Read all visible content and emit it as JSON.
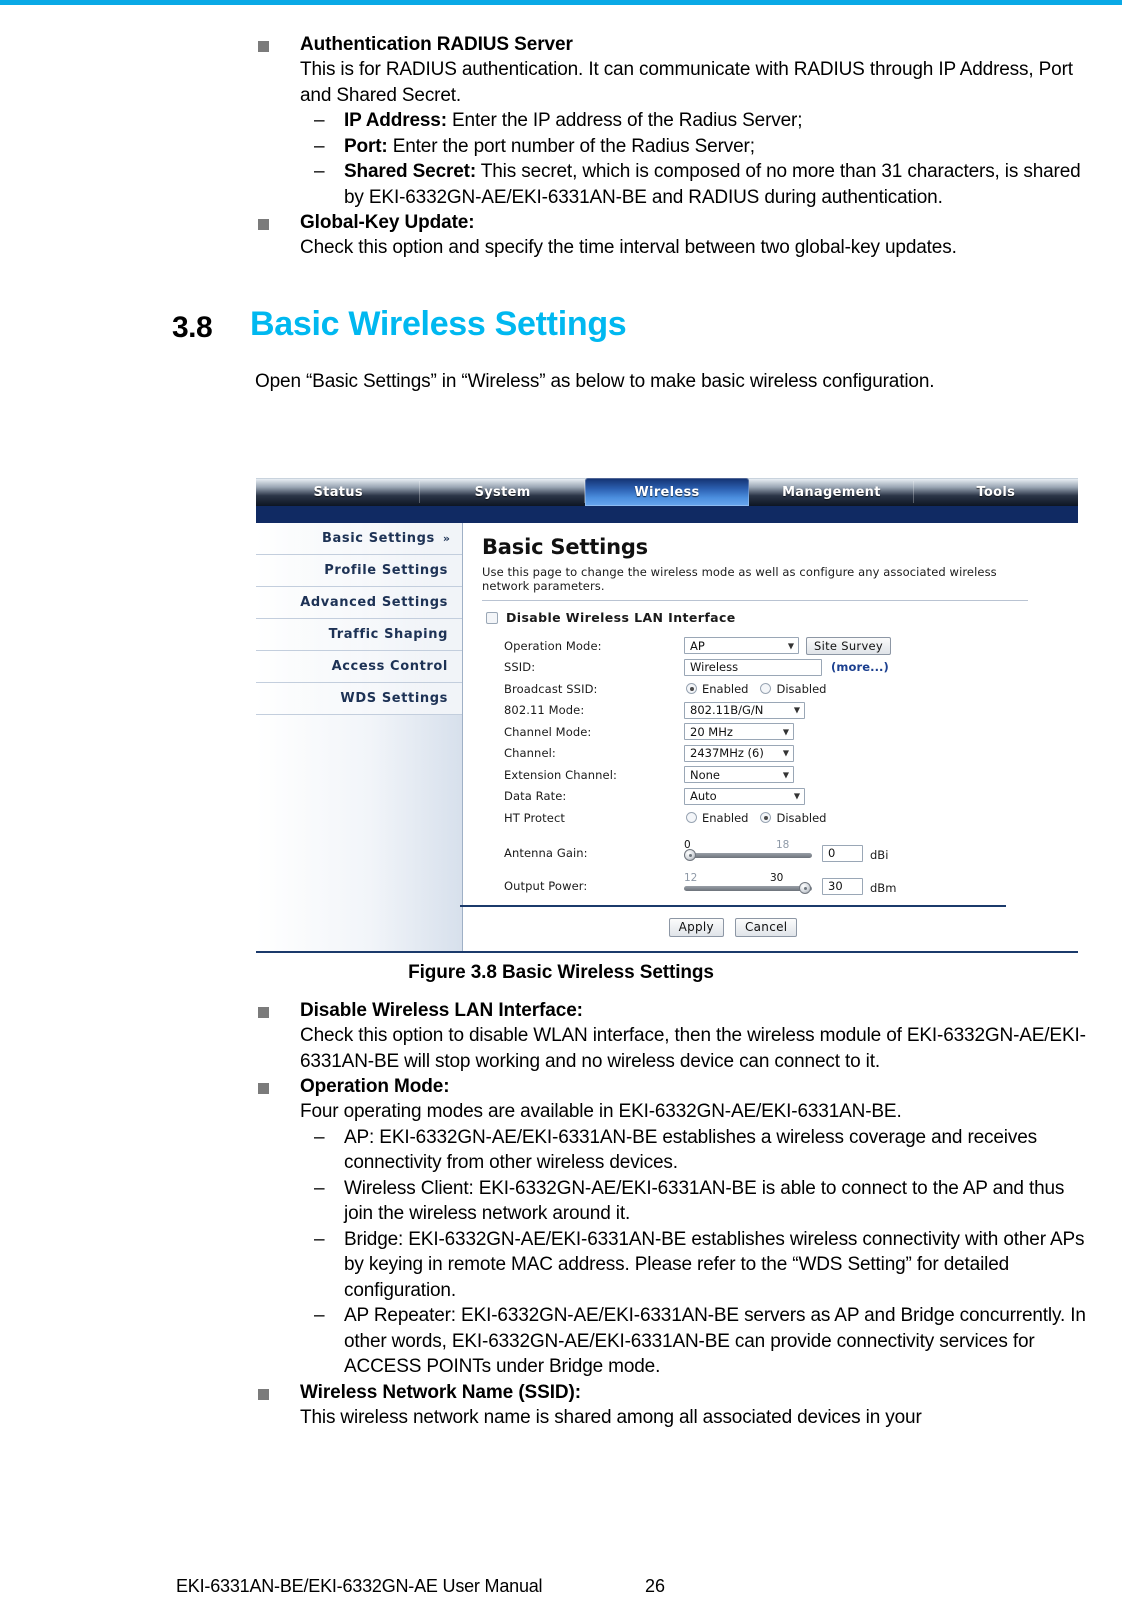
{
  "page": {
    "footer_text": "EKI-6331AN-BE/EKI-6332GN-AE User Manual",
    "page_number": "26",
    "accent_color": "#00b8f0"
  },
  "top_blocks": [
    {
      "title": "Authentication RADIUS Server",
      "body": "This is for RADIUS authentication. It can communicate with RADIUS through IP Address, Port and Shared Secret.",
      "subs": [
        {
          "lead": "IP Address:",
          "text": " Enter the IP address of the Radius Server;"
        },
        {
          "lead": "Port:",
          "text": " Enter the port number of the Radius Server;"
        },
        {
          "lead": "Shared Secret:",
          "text": " This secret, which is composed of no more than 31 characters, is shared by EKI-6332GN-AE/EKI-6331AN-BE and RADIUS during authentication."
        }
      ]
    },
    {
      "title": "Global-Key Update:",
      "body": "Check this option and specify the time interval between two global-key updates.",
      "subs": []
    }
  ],
  "section": {
    "number": "3.8",
    "title": "Basic Wireless Settings",
    "intro": "Open “Basic Settings” in “Wireless” as below to make basic wireless configuration."
  },
  "screenshot": {
    "tabs": [
      {
        "label": "Status",
        "active": false
      },
      {
        "label": "System",
        "active": false
      },
      {
        "label": "Wireless",
        "active": true
      },
      {
        "label": "Management",
        "active": false
      },
      {
        "label": "Tools",
        "active": false
      }
    ],
    "menu": [
      {
        "label": "Basic Settings",
        "arrow": "»",
        "selected": true
      },
      {
        "label": "Profile Settings",
        "arrow": "",
        "selected": false
      },
      {
        "label": "Advanced Settings",
        "arrow": "",
        "selected": false
      },
      {
        "label": "Traffic Shaping",
        "arrow": "",
        "selected": false
      },
      {
        "label": "Access Control",
        "arrow": "",
        "selected": false
      },
      {
        "label": "WDS Settings",
        "arrow": "",
        "selected": false
      }
    ],
    "panel": {
      "title": "Basic Settings",
      "description": "Use this page to change the wireless mode as well as configure any associated wireless network parameters.",
      "disable_wlan_label": "Disable Wireless LAN Interface",
      "disable_wlan_checked": false
    },
    "fields": {
      "operation_mode_label": "Operation Mode:",
      "operation_mode_value": "AP",
      "site_survey_button": "Site Survey",
      "ssid_label": "SSID:",
      "ssid_value": "Wireless",
      "more_link": "(more...)",
      "broadcast_ssid_label": "Broadcast SSID:",
      "broadcast_ssid_enabled": "Enabled",
      "broadcast_ssid_disabled": "Disabled",
      "broadcast_ssid_selected": "Enabled",
      "mode_80211_label": "802.11 Mode:",
      "mode_80211_value": "802.11B/G/N",
      "channel_mode_label": "Channel Mode:",
      "channel_mode_value": "20 MHz",
      "channel_label": "Channel:",
      "channel_value": "2437MHz (6)",
      "extension_channel_label": "Extension Channel:",
      "extension_channel_value": "None",
      "data_rate_label": "Data Rate:",
      "data_rate_value": "Auto",
      "ht_protect_label": "HT Protect",
      "ht_protect_enabled": "Enabled",
      "ht_protect_disabled": "Disabled",
      "ht_protect_selected": "Disabled",
      "antenna_gain_label": "Antenna Gain:",
      "antenna_gain_min": "0",
      "antenna_gain_max": "18",
      "antenna_gain_value": "0",
      "antenna_gain_unit": "dBi",
      "output_power_label": "Output Power:",
      "output_power_min": "12",
      "output_power_max": "30",
      "output_power_value": "30",
      "output_power_unit": "dBm"
    },
    "actions": {
      "apply": "Apply",
      "cancel": "Cancel"
    }
  },
  "figure_caption": "Figure 3.8 Basic Wireless Settings",
  "bottom_blocks": [
    {
      "title": "Disable Wireless LAN Interface:",
      "body": "Check this option to disable WLAN interface, then the wireless module of EKI-6332GN-AE/EKI-6331AN-BE will stop working and no wireless device can connect to it.",
      "subs": []
    },
    {
      "title": "Operation Mode:",
      "body": "Four operating modes are available in EKI-6332GN-AE/EKI-6331AN-BE.",
      "subs": [
        {
          "lead": "",
          "text": "AP: EKI-6332GN-AE/EKI-6331AN-BE establishes a wireless coverage and receives connectivity from other wireless devices."
        },
        {
          "lead": "",
          "text": "Wireless Client: EKI-6332GN-AE/EKI-6331AN-BE is able to connect to the AP and thus join the wireless network around it."
        },
        {
          "lead": "",
          "text": "Bridge: EKI-6332GN-AE/EKI-6331AN-BE establishes wireless connectivity with other APs by keying in remote MAC address.  Please refer to the “WDS Setting” for detailed configuration."
        },
        {
          "lead": "",
          "text": "AP Repeater: EKI-6332GN-AE/EKI-6331AN-BE servers as AP and Bridge concurrently.  In other words, EKI-6332GN-AE/EKI-6331AN-BE can provide connectivity services for ACCESS POINTs under Bridge mode."
        }
      ]
    },
    {
      "title": "Wireless Network Name (SSID):",
      "body": "This wireless network name is shared among all associated devices in your",
      "subs": []
    }
  ]
}
